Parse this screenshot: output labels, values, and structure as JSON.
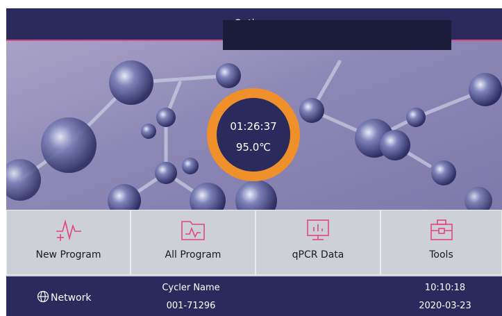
{
  "header": {
    "title": "Optimur"
  },
  "timer": {
    "elapsed": "01:26:37",
    "temperature": "95.0℃"
  },
  "tiles": [
    {
      "label": "New Program",
      "icon": "pulse-plus-icon"
    },
    {
      "label": "All Program",
      "icon": "folder-chart-icon"
    },
    {
      "label": "qPCR Data",
      "icon": "monitor-chart-icon"
    },
    {
      "label": "Tools",
      "icon": "toolbox-icon"
    }
  ],
  "footer": {
    "network_label": "Network",
    "cycler_name_label": "Cycler Name",
    "cycler_name_value": "001-71296",
    "time": "10:10:18",
    "date": "2020-03-23"
  },
  "colors": {
    "header_bg": "#2a2a5c",
    "accent_pink": "#d94a86",
    "timer_ring": "#f0902a",
    "tile_icon": "#e0457f"
  }
}
